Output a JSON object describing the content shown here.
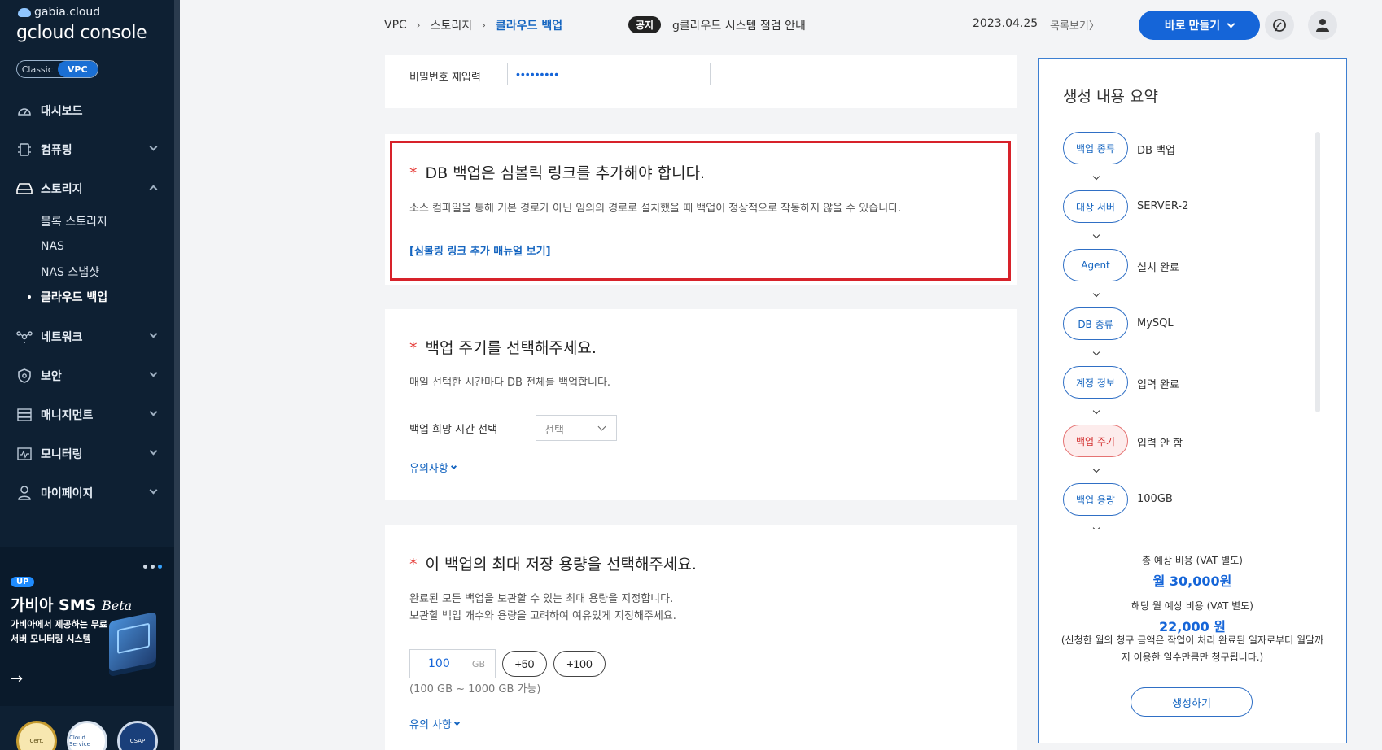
{
  "sidebar": {
    "brand_top": "gabia.cloud",
    "brand_main": "gcloud console",
    "toggle": {
      "classic": "Classic",
      "vpc": "VPC"
    },
    "items": [
      {
        "label": "대시보드"
      },
      {
        "label": "컴퓨팅"
      },
      {
        "label": "스토리지"
      },
      {
        "label": "네트워크"
      },
      {
        "label": "보안"
      },
      {
        "label": "매니지먼트"
      },
      {
        "label": "모니터링"
      },
      {
        "label": "마이페이지"
      }
    ],
    "sub_items": [
      {
        "label": "블록 스토리지"
      },
      {
        "label": "NAS"
      },
      {
        "label": "NAS 스냅샷"
      },
      {
        "label": "클라우드 백업"
      }
    ],
    "promo": {
      "badge": "UP",
      "title": "가비아 SMS",
      "title_suffix": "Beta",
      "desc": "가비아에서 제공하는 무료 서버 모니터링 시스템",
      "arrow": "→"
    },
    "certs": [
      "Cert.",
      "Cloud Service",
      "CSAP"
    ]
  },
  "header": {
    "breadcrumb": [
      "VPC",
      "스토리지",
      "클라우드 백업"
    ],
    "breadcrumb_sep": "›",
    "notice_badge": "공지",
    "notice_text": "g클라우드 시스템 점검 안내",
    "notice_date": "2023.04.25",
    "notice_more": "목록보기〉",
    "create_button": "바로 만들기"
  },
  "form": {
    "password_confirm_label": "비밀번호 재입력",
    "password_confirm_value": "•••••••••",
    "symlink": {
      "title": "DB 백업은 심볼릭 링크를 추가해야 합니다.",
      "desc": "소스 컴파일을 통해 기본 경로가 아닌 임의의 경로로 설치했을 때 백업이 정상적으로 작동하지 않을 수 있습니다.",
      "link": "[심볼링 링크 추가 매뉴얼 보기]"
    },
    "cycle": {
      "title": "백업 주기를 선택해주세요.",
      "desc": "매일 선택한 시간마다 DB 전체를 백업합니다.",
      "time_label": "백업 희망 시간 선택",
      "time_select": "선택",
      "note_link": "유의사항"
    },
    "capacity": {
      "title": "이 백업의 최대 저장 용량을 선택해주세요.",
      "desc_line1": "완료된 모든 백업을 보관할 수 있는 최대 용량을 지정합니다.",
      "desc_line2": "보관할 백업 개수와 용량을 고려하여 여유있게 지정해주세요.",
      "value": "100",
      "unit": "GB",
      "btn_50": "+50",
      "btn_100": "+100",
      "range": "(100 GB ~ 1000 GB 가능)",
      "note_link": "유의 사항"
    }
  },
  "summary": {
    "title": "생성 내용 요약",
    "steps": [
      {
        "label": "백업 종류",
        "value": "DB 백업"
      },
      {
        "label": "대상 서버",
        "value": "SERVER-2"
      },
      {
        "label": "Agent",
        "value": "설치 완료"
      },
      {
        "label": "DB 종류",
        "value": "MySQL"
      },
      {
        "label": "계정 정보",
        "value": "입력 완료"
      },
      {
        "label": "백업 주기",
        "value": "입력 안 함"
      },
      {
        "label": "백업 용량",
        "value": "100GB"
      }
    ],
    "total_label": "총 예상 비용 (VAT 별도)",
    "total_value": "월 30,000원",
    "month_label": "해당 월 예상 비용 (VAT 별도)",
    "month_value": "22,000 원",
    "note": "(신청한 월의 청구 금액은 작업이 처리 완료된 일자로부터 월말까지 이용한 일수만큼만 청구됩니다.)",
    "create_button": "생성하기"
  },
  "colors": {
    "sidebar_bg": "#0e2033",
    "accent": "#1565d8",
    "warn": "#d7222a"
  }
}
